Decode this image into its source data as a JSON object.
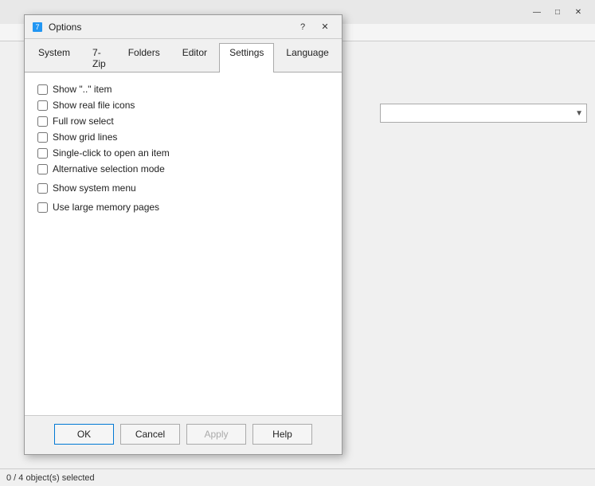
{
  "background": {
    "titlebar_buttons": [
      "—",
      "□",
      "✕"
    ],
    "statusbar_text": "0 / 4 object(s) selected"
  },
  "dialog": {
    "title": "Options",
    "help_label": "?",
    "close_label": "✕",
    "tabs": [
      {
        "label": "System",
        "active": false
      },
      {
        "label": "7-Zip",
        "active": false
      },
      {
        "label": "Folders",
        "active": false
      },
      {
        "label": "Editor",
        "active": false
      },
      {
        "label": "Settings",
        "active": true
      },
      {
        "label": "Language",
        "active": false
      }
    ],
    "checkboxes": [
      {
        "id": "cb1",
        "label": "Show \"..\" item",
        "checked": false
      },
      {
        "id": "cb2",
        "label": "Show real file icons",
        "checked": false
      },
      {
        "id": "cb3",
        "label": "Full row select",
        "checked": false
      },
      {
        "id": "cb4",
        "label": "Show grid lines",
        "checked": false
      },
      {
        "id": "cb5",
        "label": "Single-click to open an item",
        "checked": false
      },
      {
        "id": "cb6",
        "label": "Alternative selection mode",
        "checked": false
      },
      {
        "id": "cb7",
        "label": "Show system menu",
        "checked": false,
        "gap": true
      },
      {
        "id": "cb8",
        "label": "Use large memory pages",
        "checked": false,
        "gap": true
      }
    ],
    "buttons": [
      {
        "label": "OK",
        "type": "primary"
      },
      {
        "label": "Cancel",
        "type": "normal"
      },
      {
        "label": "Apply",
        "type": "disabled"
      },
      {
        "label": "Help",
        "type": "normal"
      }
    ]
  }
}
